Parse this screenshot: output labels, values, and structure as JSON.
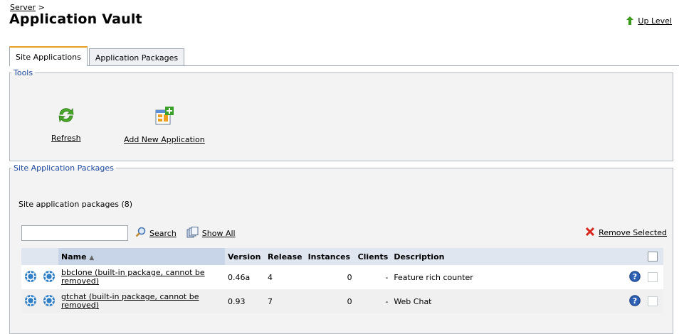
{
  "breadcrumb": {
    "server": "Server",
    "sep": ">"
  },
  "page_title": "Application Vault",
  "up_level": {
    "label": "Up Level",
    "icon": "up-arrow-icon"
  },
  "tabs": [
    {
      "label": "Site Applications",
      "active": true
    },
    {
      "label": "Application Packages",
      "active": false
    }
  ],
  "tools": {
    "legend": "Tools",
    "items": [
      {
        "label": "Refresh",
        "icon": "refresh-icon"
      },
      {
        "label": "Add New Application",
        "icon": "add-application-icon"
      }
    ]
  },
  "packages": {
    "legend": "Site Application Packages",
    "count_text": "Site application packages (8)",
    "search": {
      "value": "",
      "button": "Search",
      "show_all": "Show All"
    },
    "remove_selected": "Remove Selected",
    "columns": {
      "name": "Name",
      "sort_indicator": "▲",
      "version": "Version",
      "release": "Release",
      "instances": "Instances",
      "clients": "Clients",
      "description": "Description"
    },
    "rows": [
      {
        "name": "bbclone (built-in package, cannot be removed)",
        "version": "0.46a",
        "release": "4",
        "instances": "0",
        "clients": "-",
        "description": "Feature rich counter"
      },
      {
        "name": "gtchat (built-in package, cannot be removed)",
        "version": "0.93",
        "release": "7",
        "instances": "0",
        "clients": "-",
        "description": "Web Chat"
      }
    ]
  },
  "colors": {
    "accent_tab": "#e8a020",
    "legend_text": "#1f4aa0",
    "header_bg": "#dfe6f0",
    "remove_icon": "#d9261c",
    "up_arrow": "#3a9a1a"
  }
}
